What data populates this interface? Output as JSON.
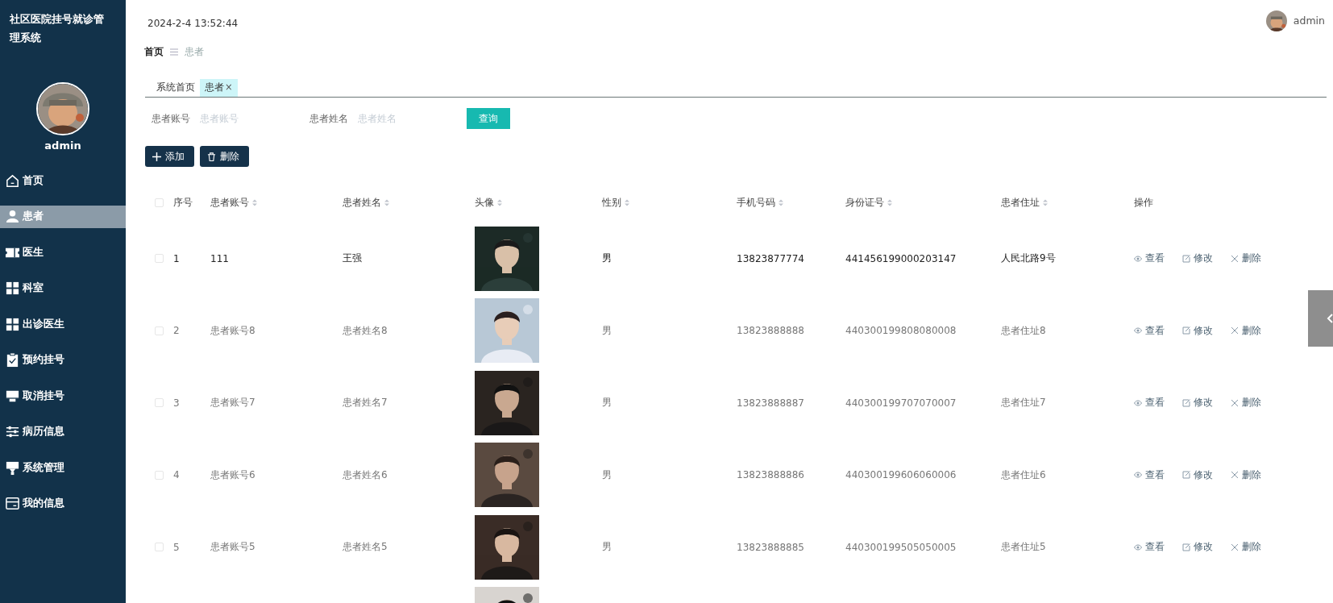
{
  "sidebar": {
    "title": "社区医院挂号就诊管理系统",
    "avatar": {
      "kind": "picture"
    },
    "user": "admin",
    "items": [
      {
        "label": "首页",
        "kind": "home",
        "selected": false
      },
      {
        "label": "患者",
        "kind": "user",
        "selected": true
      },
      {
        "label": "医生",
        "kind": "ticket",
        "selected": false
      },
      {
        "label": "科室",
        "kind": "grid",
        "selected": false
      },
      {
        "label": "出诊医生",
        "kind": "grid",
        "selected": false
      },
      {
        "label": "预约挂号",
        "kind": "clipboard",
        "selected": false
      },
      {
        "label": "取消挂号",
        "kind": "tray",
        "selected": false
      },
      {
        "label": "病历信息",
        "kind": "sliders",
        "selected": false
      },
      {
        "label": "系统管理",
        "kind": "stamp",
        "selected": false
      },
      {
        "label": "我的信息",
        "kind": "card",
        "selected": false
      }
    ]
  },
  "header": {
    "datetime": "2024-2-4 13:52:44",
    "user": "admin"
  },
  "breadcrumb": [
    "首页",
    "患者"
  ],
  "tabs": [
    {
      "label": "系统首页",
      "selected": false,
      "closable": false
    },
    {
      "label": "患者",
      "selected": true,
      "closable": true
    }
  ],
  "tab_close": "×",
  "search": {
    "fields": [
      {
        "label": "患者账号",
        "placeholder": "患者账号"
      },
      {
        "label": "患者姓名",
        "placeholder": "患者姓名"
      }
    ],
    "button": "查询"
  },
  "actions": [
    {
      "kind": "add",
      "label": "添加"
    },
    {
      "kind": "delete",
      "label": "删除"
    }
  ],
  "table": {
    "columns": [
      {
        "label": "序号",
        "sortable": false
      },
      {
        "label": "患者账号",
        "sortable": true
      },
      {
        "label": "患者姓名",
        "sortable": true
      },
      {
        "label": "头像",
        "sortable": true
      },
      {
        "label": "性别",
        "sortable": true
      },
      {
        "label": "手机号码",
        "sortable": true
      },
      {
        "label": "身份证号",
        "sortable": true
      },
      {
        "label": "患者住址",
        "sortable": true
      },
      {
        "label": "操作",
        "sortable": false
      }
    ],
    "header_checked": false,
    "rows": [
      {
        "checked": false,
        "highlighted": true,
        "seq": "1",
        "account": "111",
        "name": "王强",
        "avatar": {
          "kind": "picture"
        },
        "gender": "男",
        "phone": "13823877774",
        "id_no": "441456199000203147",
        "address": "人民北路9号",
        "actions": [
          {
            "kind": "view",
            "label": "查看"
          },
          {
            "kind": "edit",
            "label": "修改"
          },
          {
            "kind": "delete",
            "label": "删除"
          }
        ]
      },
      {
        "checked": false,
        "highlighted": false,
        "seq": "2",
        "account": "患者账号8",
        "name": "患者姓名8",
        "avatar": {
          "kind": "picture"
        },
        "gender": "男",
        "phone": "13823888888",
        "id_no": "440300199808080008",
        "address": "患者住址8",
        "actions": [
          {
            "kind": "view",
            "label": "查看"
          },
          {
            "kind": "edit",
            "label": "修改"
          },
          {
            "kind": "delete",
            "label": "删除"
          }
        ]
      },
      {
        "checked": false,
        "highlighted": false,
        "seq": "3",
        "account": "患者账号7",
        "name": "患者姓名7",
        "avatar": {
          "kind": "picture"
        },
        "gender": "男",
        "phone": "13823888887",
        "id_no": "440300199707070007",
        "address": "患者住址7",
        "actions": [
          {
            "kind": "view",
            "label": "查看"
          },
          {
            "kind": "edit",
            "label": "修改"
          },
          {
            "kind": "delete",
            "label": "删除"
          }
        ]
      },
      {
        "checked": false,
        "highlighted": false,
        "seq": "4",
        "account": "患者账号6",
        "name": "患者姓名6",
        "avatar": {
          "kind": "picture"
        },
        "gender": "男",
        "phone": "13823888886",
        "id_no": "440300199606060006",
        "address": "患者住址6",
        "actions": [
          {
            "kind": "view",
            "label": "查看"
          },
          {
            "kind": "edit",
            "label": "修改"
          },
          {
            "kind": "delete",
            "label": "删除"
          }
        ]
      },
      {
        "checked": false,
        "highlighted": false,
        "seq": "5",
        "account": "患者账号5",
        "name": "患者姓名5",
        "avatar": {
          "kind": "picture"
        },
        "gender": "男",
        "phone": "13823888885",
        "id_no": "440300199505050005",
        "address": "患者住址5",
        "actions": [
          {
            "kind": "view",
            "label": "查看"
          },
          {
            "kind": "edit",
            "label": "修改"
          },
          {
            "kind": "delete",
            "label": "删除"
          }
        ]
      },
      {
        "avatar": {
          "kind": "picture"
        }
      }
    ]
  }
}
